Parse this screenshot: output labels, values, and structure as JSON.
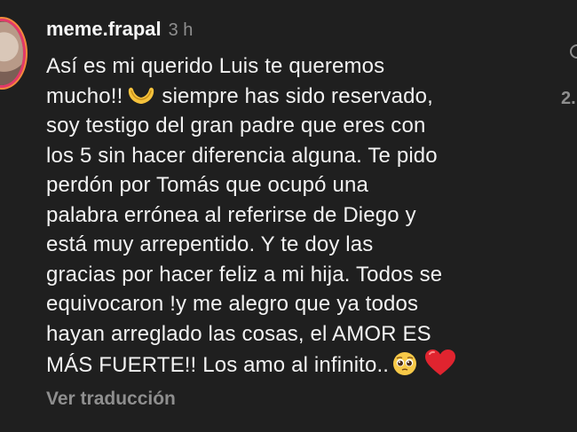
{
  "comment": {
    "username": "meme.frapal",
    "timestamp": "3 h",
    "lines": {
      "l1": "Así es mi querido Luis te queremos",
      "l2a": "mucho!!",
      "l2b": "siempre has sido reservado,",
      "l3": "soy testigo del gran padre que eres con",
      "l4": "los 5 sin hacer diferencia alguna. Te pido",
      "l5": "perdón por Tomás que ocupó una",
      "l6": "palabra errónea al referirse de Diego y",
      "l7": "está muy arrepentido. Y te doy las",
      "l8": "gracias por hacer feliz a mi hija. Todos se",
      "l9": "equivocaron !y me alegro que ya todos",
      "l10": "hayan arreglado las cosas, el AMOR ES",
      "l11": "MÁS FUERTE!! Los amo al infinito.."
    },
    "emojis": [
      "heart-hands",
      "pleading-face",
      "red-heart"
    ],
    "translate_label": "Ver traducción"
  },
  "side": {
    "like_count": "2."
  },
  "colors": {
    "background": "#1f1f1f",
    "text": "#f2f2f2",
    "muted": "#8e8e8e",
    "heart": "#e0242f"
  }
}
